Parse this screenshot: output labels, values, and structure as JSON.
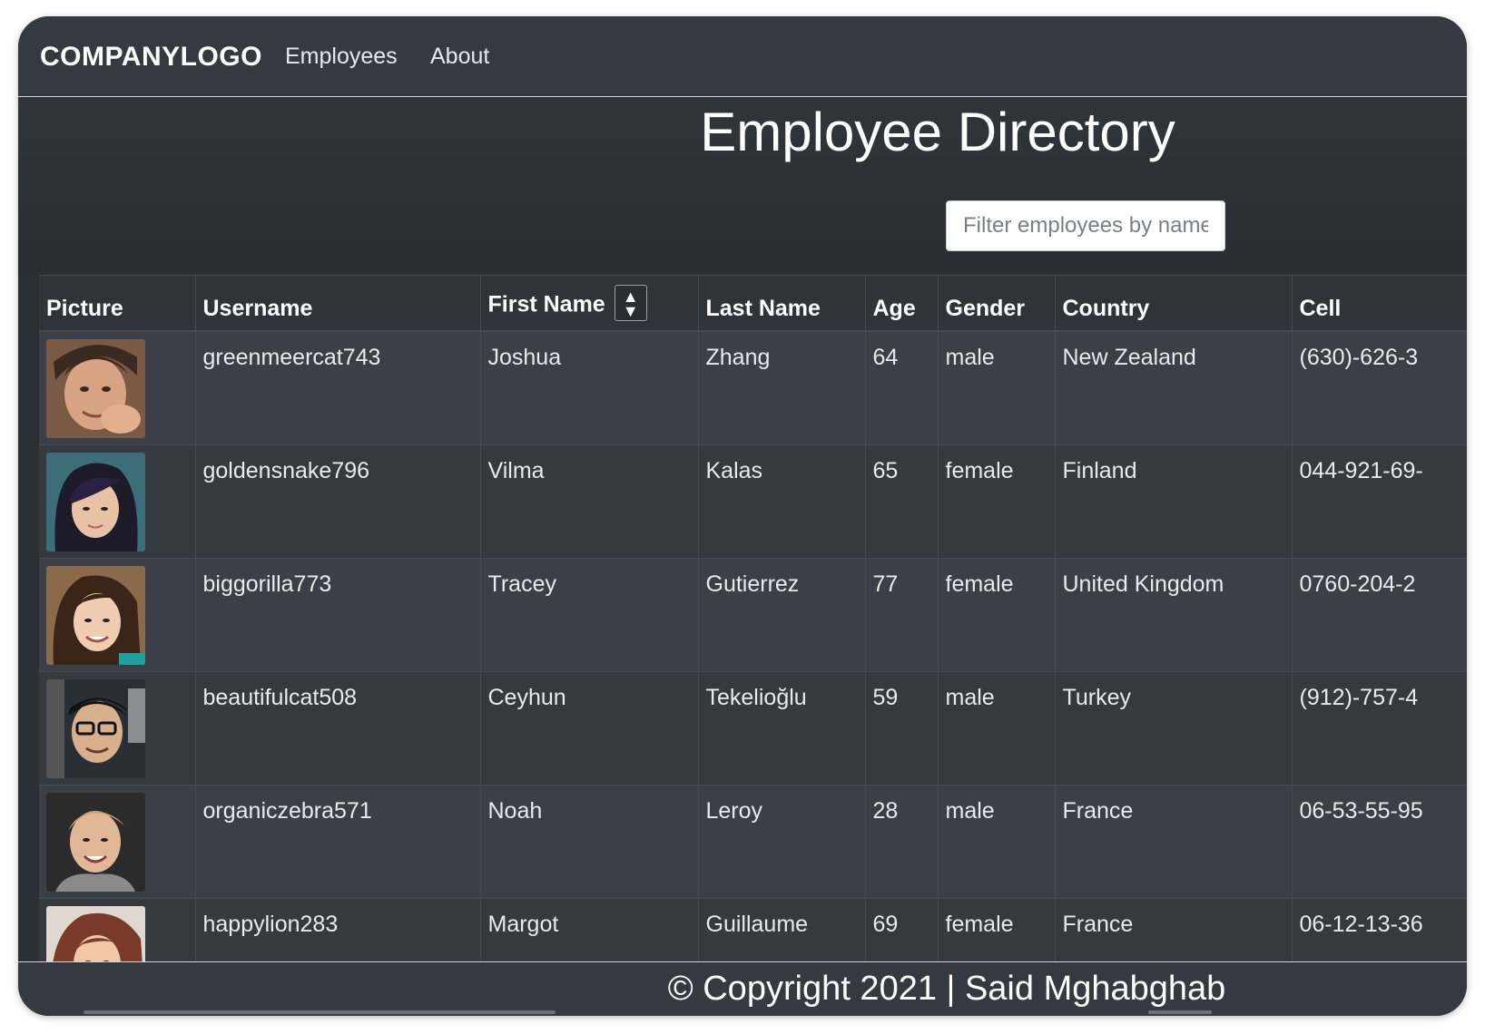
{
  "nav": {
    "brand": "COMPANYLOGO",
    "links": [
      "Employees",
      "About"
    ]
  },
  "main": {
    "title": "Employee Directory",
    "search_placeholder": "Filter employees by name"
  },
  "table": {
    "columns": [
      "Picture",
      "Username",
      "First Name",
      "Last Name",
      "Age",
      "Gender",
      "Country",
      "Cell"
    ],
    "sort_icon": "sort-icon",
    "rows": [
      {
        "username": "greenmeercat743",
        "first": "Joshua",
        "last": "Zhang",
        "age": "64",
        "gender": "male",
        "country": "New Zealand",
        "cell": "(630)-626-3"
      },
      {
        "username": "goldensnake796",
        "first": "Vilma",
        "last": "Kalas",
        "age": "65",
        "gender": "female",
        "country": "Finland",
        "cell": "044-921-69-"
      },
      {
        "username": "biggorilla773",
        "first": "Tracey",
        "last": "Gutierrez",
        "age": "77",
        "gender": "female",
        "country": "United Kingdom",
        "cell": "0760-204-2"
      },
      {
        "username": "beautifulcat508",
        "first": "Ceyhun",
        "last": "Tekelioğlu",
        "age": "59",
        "gender": "male",
        "country": "Turkey",
        "cell": "(912)-757-4"
      },
      {
        "username": "organiczebra571",
        "first": "Noah",
        "last": "Leroy",
        "age": "28",
        "gender": "male",
        "country": "France",
        "cell": "06-53-55-95"
      },
      {
        "username": "happylion283",
        "first": "Margot",
        "last": "Guillaume",
        "age": "69",
        "gender": "female",
        "country": "France",
        "cell": "06-12-13-36"
      }
    ]
  },
  "footer": {
    "copyright": "© Copyright 2021 | Said Mghabghab"
  },
  "colors": {
    "background": "#2b2f36",
    "navbar": "#353a42",
    "row_odd": "#3b4048",
    "row_even": "#353a41",
    "text": "#ffffff"
  }
}
